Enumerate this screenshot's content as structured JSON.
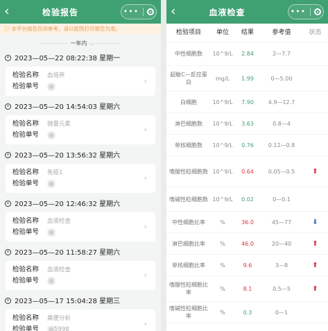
{
  "left": {
    "nav_title": "检验报告",
    "back_glyph": "‹",
    "notice": "本平台报告仅供参考，请以医院打印报告为准。",
    "filter_label": "一年内",
    "records": [
      {
        "datetime": "2023—05—22 08:22:38 星期一",
        "name_key": "检验名称",
        "name": "血培养",
        "no_key": "检验单号",
        "no": ""
      },
      {
        "datetime": "2023—05—20 14:54:03 星期六",
        "name_key": "检验名称",
        "name": "微量元素",
        "no_key": "检验单号",
        "no": ""
      },
      {
        "datetime": "2023—05—20 13:56:32 星期六",
        "name_key": "检验名称",
        "name": "免疫1",
        "no_key": "检验单号",
        "no": ""
      },
      {
        "datetime": "2023—05—20 12:46:32 星期六",
        "name_key": "检验名称",
        "name": "血液检查",
        "no_key": "检验单号",
        "no": ""
      },
      {
        "datetime": "2023—05—20 11:58:27 星期六",
        "name_key": "检验名称",
        "name": "血液检查",
        "no_key": "检验单号",
        "no": ""
      },
      {
        "datetime": "2023—05—17 15:04:28 星期三",
        "name_key": "检验名称",
        "name": "粪便分析",
        "no_key": "检验单号",
        "no": "5998"
      }
    ]
  },
  "right": {
    "nav_title": "血液检查",
    "back_glyph": "‹",
    "headers": {
      "name": "检验项目",
      "unit": "单位",
      "result": "结果",
      "ref": "参考值",
      "status": "状态"
    },
    "rows": [
      {
        "name": "中性细胞数",
        "unit": "10^9/L",
        "result": "2.84",
        "ref": "2—7.7",
        "abnormal": false,
        "flag": ""
      },
      {
        "name": "超敏C—反应蛋白",
        "unit": "mg/L",
        "result": "1.99",
        "ref": "0—5.00",
        "abnormal": false,
        "flag": ""
      },
      {
        "name": "白细胞",
        "unit": "10^9/L",
        "result": "7.90",
        "ref": "4.9—12.7",
        "abnormal": false,
        "flag": ""
      },
      {
        "name": "淋巴细胞数",
        "unit": "10^9/L",
        "result": "3.63",
        "ref": "0.8—4",
        "abnormal": false,
        "flag": ""
      },
      {
        "name": "单核细胞数",
        "unit": "10^9/L",
        "result": "0.76",
        "ref": "0.12—0.8",
        "abnormal": false,
        "flag": ""
      },
      {
        "name": "嗜酸性粒细胞数",
        "unit": "10^9/L",
        "result": "0.64",
        "ref": "0.05—0.5",
        "abnormal": true,
        "flag": "up"
      },
      {
        "name": "嗜碱性粒细胞数",
        "unit": "10^9/L",
        "result": "0.02",
        "ref": "0—0.1",
        "abnormal": false,
        "flag": ""
      },
      {
        "name": "中性细胞比率",
        "unit": "%",
        "result": "36.0",
        "ref": "45—77",
        "abnormal": true,
        "flag": "down"
      },
      {
        "name": "淋巴细胞比率",
        "unit": "%",
        "result": "46.0",
        "ref": "20—40",
        "abnormal": true,
        "flag": "up"
      },
      {
        "name": "单核细胞比率",
        "unit": "%",
        "result": "9.6",
        "ref": "3—8",
        "abnormal": true,
        "flag": "up"
      },
      {
        "name": "嗜酸性粒细胞比率",
        "unit": "%",
        "result": "8.1",
        "ref": "0.5—5",
        "abnormal": true,
        "flag": "up"
      },
      {
        "name": "嗜碱性粒细胞比率",
        "unit": "%",
        "result": "0.3",
        "ref": "0—1",
        "abnormal": false,
        "flag": ""
      }
    ]
  },
  "colors": {
    "nav": "#3fa072",
    "normal_result": "#3fa072",
    "abnormal_result": "#d9333f",
    "up_arrow": "#d9333f",
    "down_arrow": "#3b6fc7",
    "notice_bg": "#fdf1e2",
    "notice_text": "#e6a05a"
  },
  "icons": {
    "back": "chevron-left-icon",
    "more": "more-dots-icon",
    "close": "target-circle-icon",
    "clock": "clock-icon",
    "chevron": "chevron-right-icon",
    "up": "arrow-up-icon",
    "down": "arrow-down-icon"
  }
}
